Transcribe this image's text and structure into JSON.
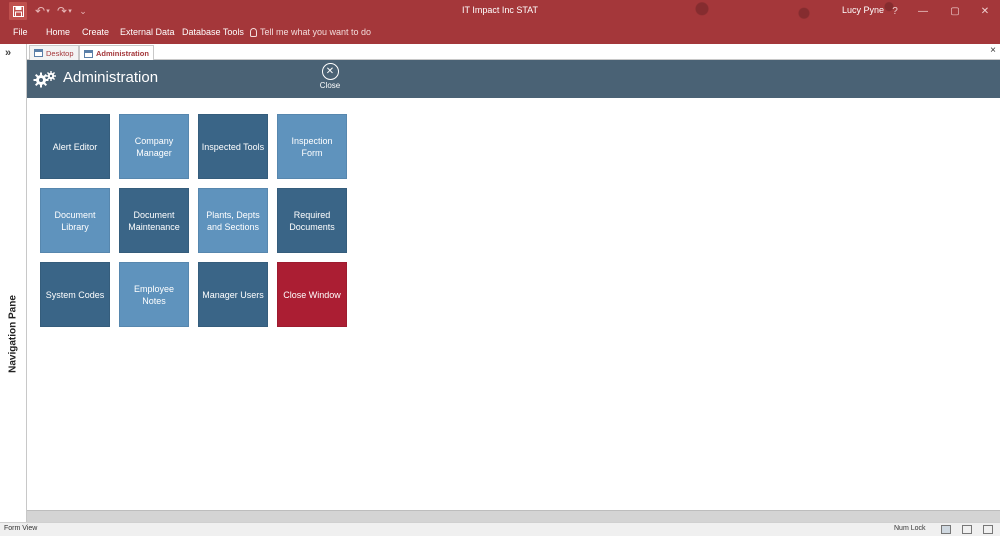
{
  "window": {
    "title": "IT Impact Inc STAT",
    "user": "Lucy Pyne",
    "help": "?",
    "minimize": "—",
    "restore": "▢",
    "close": "✕",
    "accent": "#a4373a"
  },
  "quick_access": {
    "undo": "↶",
    "redo": "↷",
    "dropdown": "▾",
    "customize": "⌄"
  },
  "ribbon": {
    "tabs": [
      "File",
      "Home",
      "Create",
      "External Data",
      "Database Tools"
    ],
    "tell_me": "Tell me what you want to do"
  },
  "nav_pane": {
    "expand": "»",
    "label": "Navigation Pane"
  },
  "document_tabs": {
    "tabs": [
      {
        "label": "Desktop",
        "active": false
      },
      {
        "label": "Administration",
        "active": true
      }
    ],
    "close": "×"
  },
  "form": {
    "title": "Administration",
    "close_label": "Close",
    "close_glyph": "✕",
    "header_color": "#4a6275"
  },
  "tiles": [
    {
      "label": "Alert Editor",
      "style": "dark"
    },
    {
      "label": "Company Manager",
      "style": "light"
    },
    {
      "label": "Inspected Tools",
      "style": "dark"
    },
    {
      "label": "Inspection Form",
      "style": "light"
    },
    {
      "label": "Document Library",
      "style": "light"
    },
    {
      "label": "Document Maintenance",
      "style": "dark"
    },
    {
      "label": "Plants, Depts and Sections",
      "style": "light"
    },
    {
      "label": "Required Documents",
      "style": "dark"
    },
    {
      "label": "System Codes",
      "style": "dark"
    },
    {
      "label": "Employee Notes",
      "style": "light"
    },
    {
      "label": "Manager Users",
      "style": "dark"
    },
    {
      "label": "Close Window",
      "style": "red"
    }
  ],
  "status_bar": {
    "left": "Form View",
    "num_lock": "Num Lock"
  }
}
